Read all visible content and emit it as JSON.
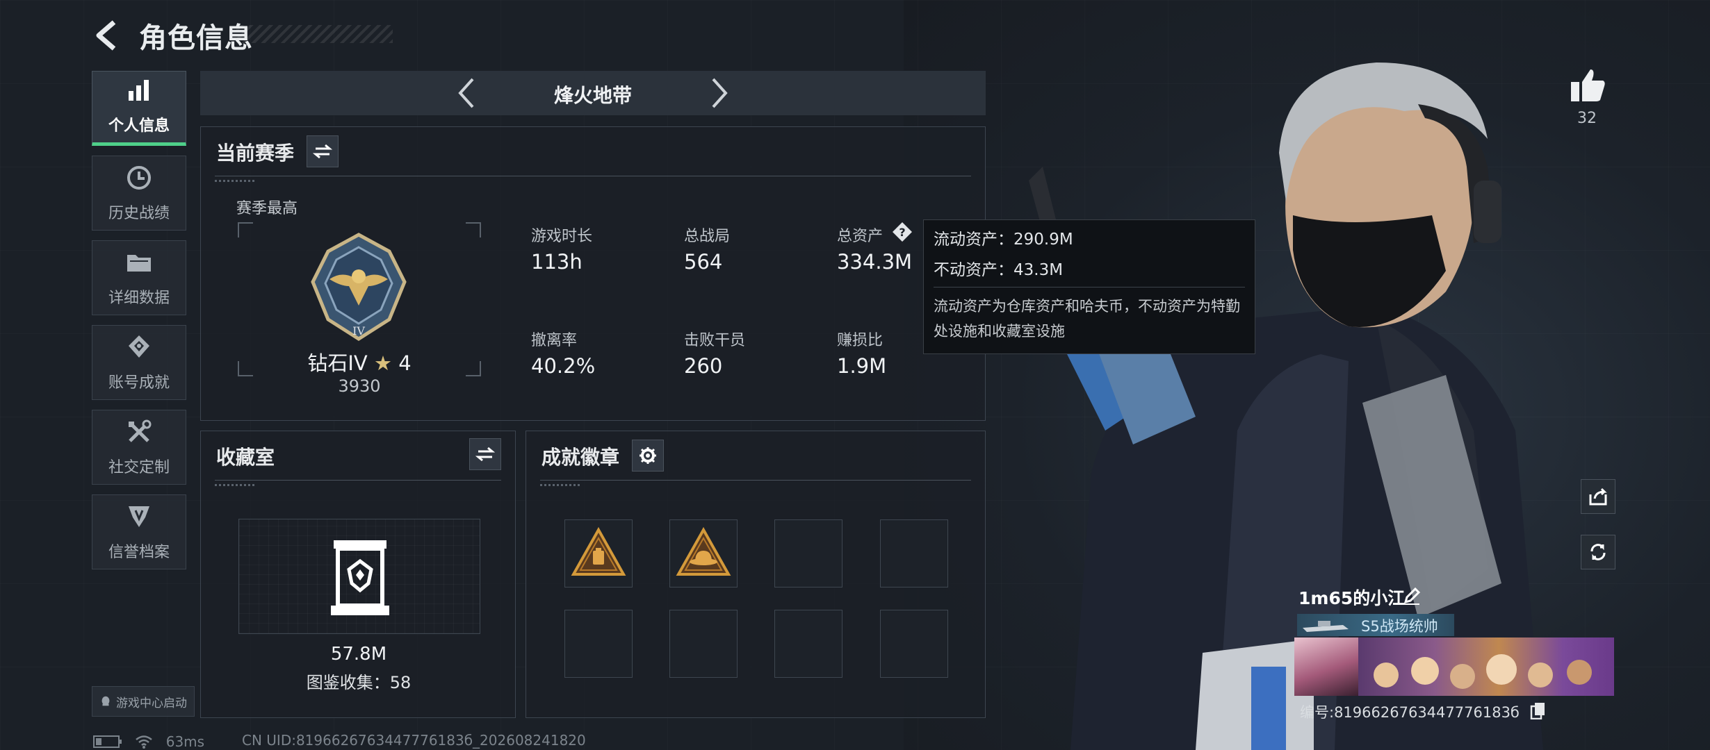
{
  "header": {
    "title": "角色信息",
    "back_icon": "back-arrow-icon"
  },
  "sidebar": {
    "items": [
      {
        "label": "个人信息",
        "icon": "bar-chart-icon",
        "active": true
      },
      {
        "label": "历史战绩",
        "icon": "clock-icon",
        "active": false
      },
      {
        "label": "详细数据",
        "icon": "folder-icon",
        "active": false
      },
      {
        "label": "账号成就",
        "icon": "achievement-icon",
        "active": false
      },
      {
        "label": "社交定制",
        "icon": "tools-icon",
        "active": false
      },
      {
        "label": "信誉档案",
        "icon": "shield-icon",
        "active": false
      }
    ],
    "launch_label": "游戏中心启动"
  },
  "mode": {
    "title": "烽火地带"
  },
  "season": {
    "title": "当前赛季",
    "best_label": "赛季最高",
    "rank_name": "钻石IV",
    "rank_stars": "4",
    "rank_score": "3930",
    "stats": [
      {
        "label": "游戏时长",
        "value": "113h"
      },
      {
        "label": "总战局",
        "value": "564"
      },
      {
        "label": "总资产",
        "value": "334.3M"
      },
      {
        "label": "撤离率",
        "value": "40.2%"
      },
      {
        "label": "击败干员",
        "value": "260"
      },
      {
        "label": "赚损比",
        "value": "1.9M"
      }
    ]
  },
  "tooltip": {
    "liquid": "流动资产：290.9M",
    "fixed": "不动资产：43.3M",
    "desc": "流动资产为仓库资产和哈夫币，不动资产为特勤处设施和收藏室设施"
  },
  "collection": {
    "title": "收藏室",
    "value": "57.8M",
    "collect_label": "图鉴收集：58"
  },
  "badges": {
    "title": "成就徽章",
    "slots": [
      "badge-1",
      "badge-2",
      "",
      "",
      "",
      "",
      "",
      ""
    ]
  },
  "profile": {
    "likes": "32",
    "name": "1m65的小江",
    "title_badge": "S5战场统帅",
    "id_text": "编号:8196626763447776183б"
  },
  "status": {
    "ping": "63ms",
    "uid": "CN UID:8196626763447776183б_202608241820"
  },
  "colors": {
    "accent": "#4fd08a",
    "panel_border": "#3d4550",
    "background": "#1b2027"
  }
}
